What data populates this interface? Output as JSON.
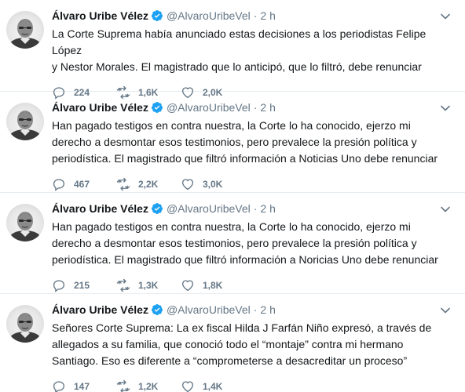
{
  "colors": {
    "text": "#14171a",
    "muted": "#657786",
    "verified": "#1da1f2",
    "divider": "#e6ecf0"
  },
  "icons": {
    "reply": "reply-icon",
    "retweet": "retweet-icon",
    "like": "heart-icon",
    "verified": "verified-badge-icon",
    "menu": "chevron-down-icon"
  },
  "tweets": [
    {
      "name": "Álvaro Uribe Vélez",
      "handle": "@AlvaroUribeVel",
      "separator": "·",
      "time": "2 h",
      "text": "La Corte Suprema había anunciado estas decisiones a los periodistas Felipe López\ny Nestor Morales. El magistrado que lo anticipó, que lo filtró, debe renunciar",
      "replies": "224",
      "retweets": "1,6K",
      "likes": "2,0K"
    },
    {
      "name": "Álvaro Uribe Vélez",
      "handle": "@AlvaroUribeVel",
      "separator": "·",
      "time": "2 h",
      "text": "Han pagado testigos en contra nuestra, la Corte lo ha conocido, ejerzo mi\nderecho a desmontar esos testimonios, pero prevalece la presión política y\nperiodística. El magistrado que filtró información a Noticias Uno debe renunciar",
      "replies": "467",
      "retweets": "2,2K",
      "likes": "3,0K"
    },
    {
      "name": "Álvaro Uribe Vélez",
      "handle": "@AlvaroUribeVel",
      "separator": "·",
      "time": "2 h",
      "text": "Han pagado testigos en contra nuestra, la Corte lo ha conocido, ejerzo mi\nderecho a desmontar esos testimonios, pero prevalece la presión política y\nperiodística. El magistrado que filtró información a Noricias Uno debe renunciar",
      "replies": "215",
      "retweets": "1,3K",
      "likes": "1,8K"
    },
    {
      "name": "Álvaro Uribe Vélez",
      "handle": "@AlvaroUribeVel",
      "separator": "·",
      "time": "2 h",
      "text": "Señores Corte Suprema: La ex fiscal Hilda J Farfán Niño expresó, a través de\nallegados a su familia, que conoció todo el “montaje” contra mi hermano\nSantiago. Eso es diferente a “comprometerse a desacreditar un proceso”",
      "replies": "147",
      "retweets": "1,2K",
      "likes": "1,4K"
    }
  ]
}
